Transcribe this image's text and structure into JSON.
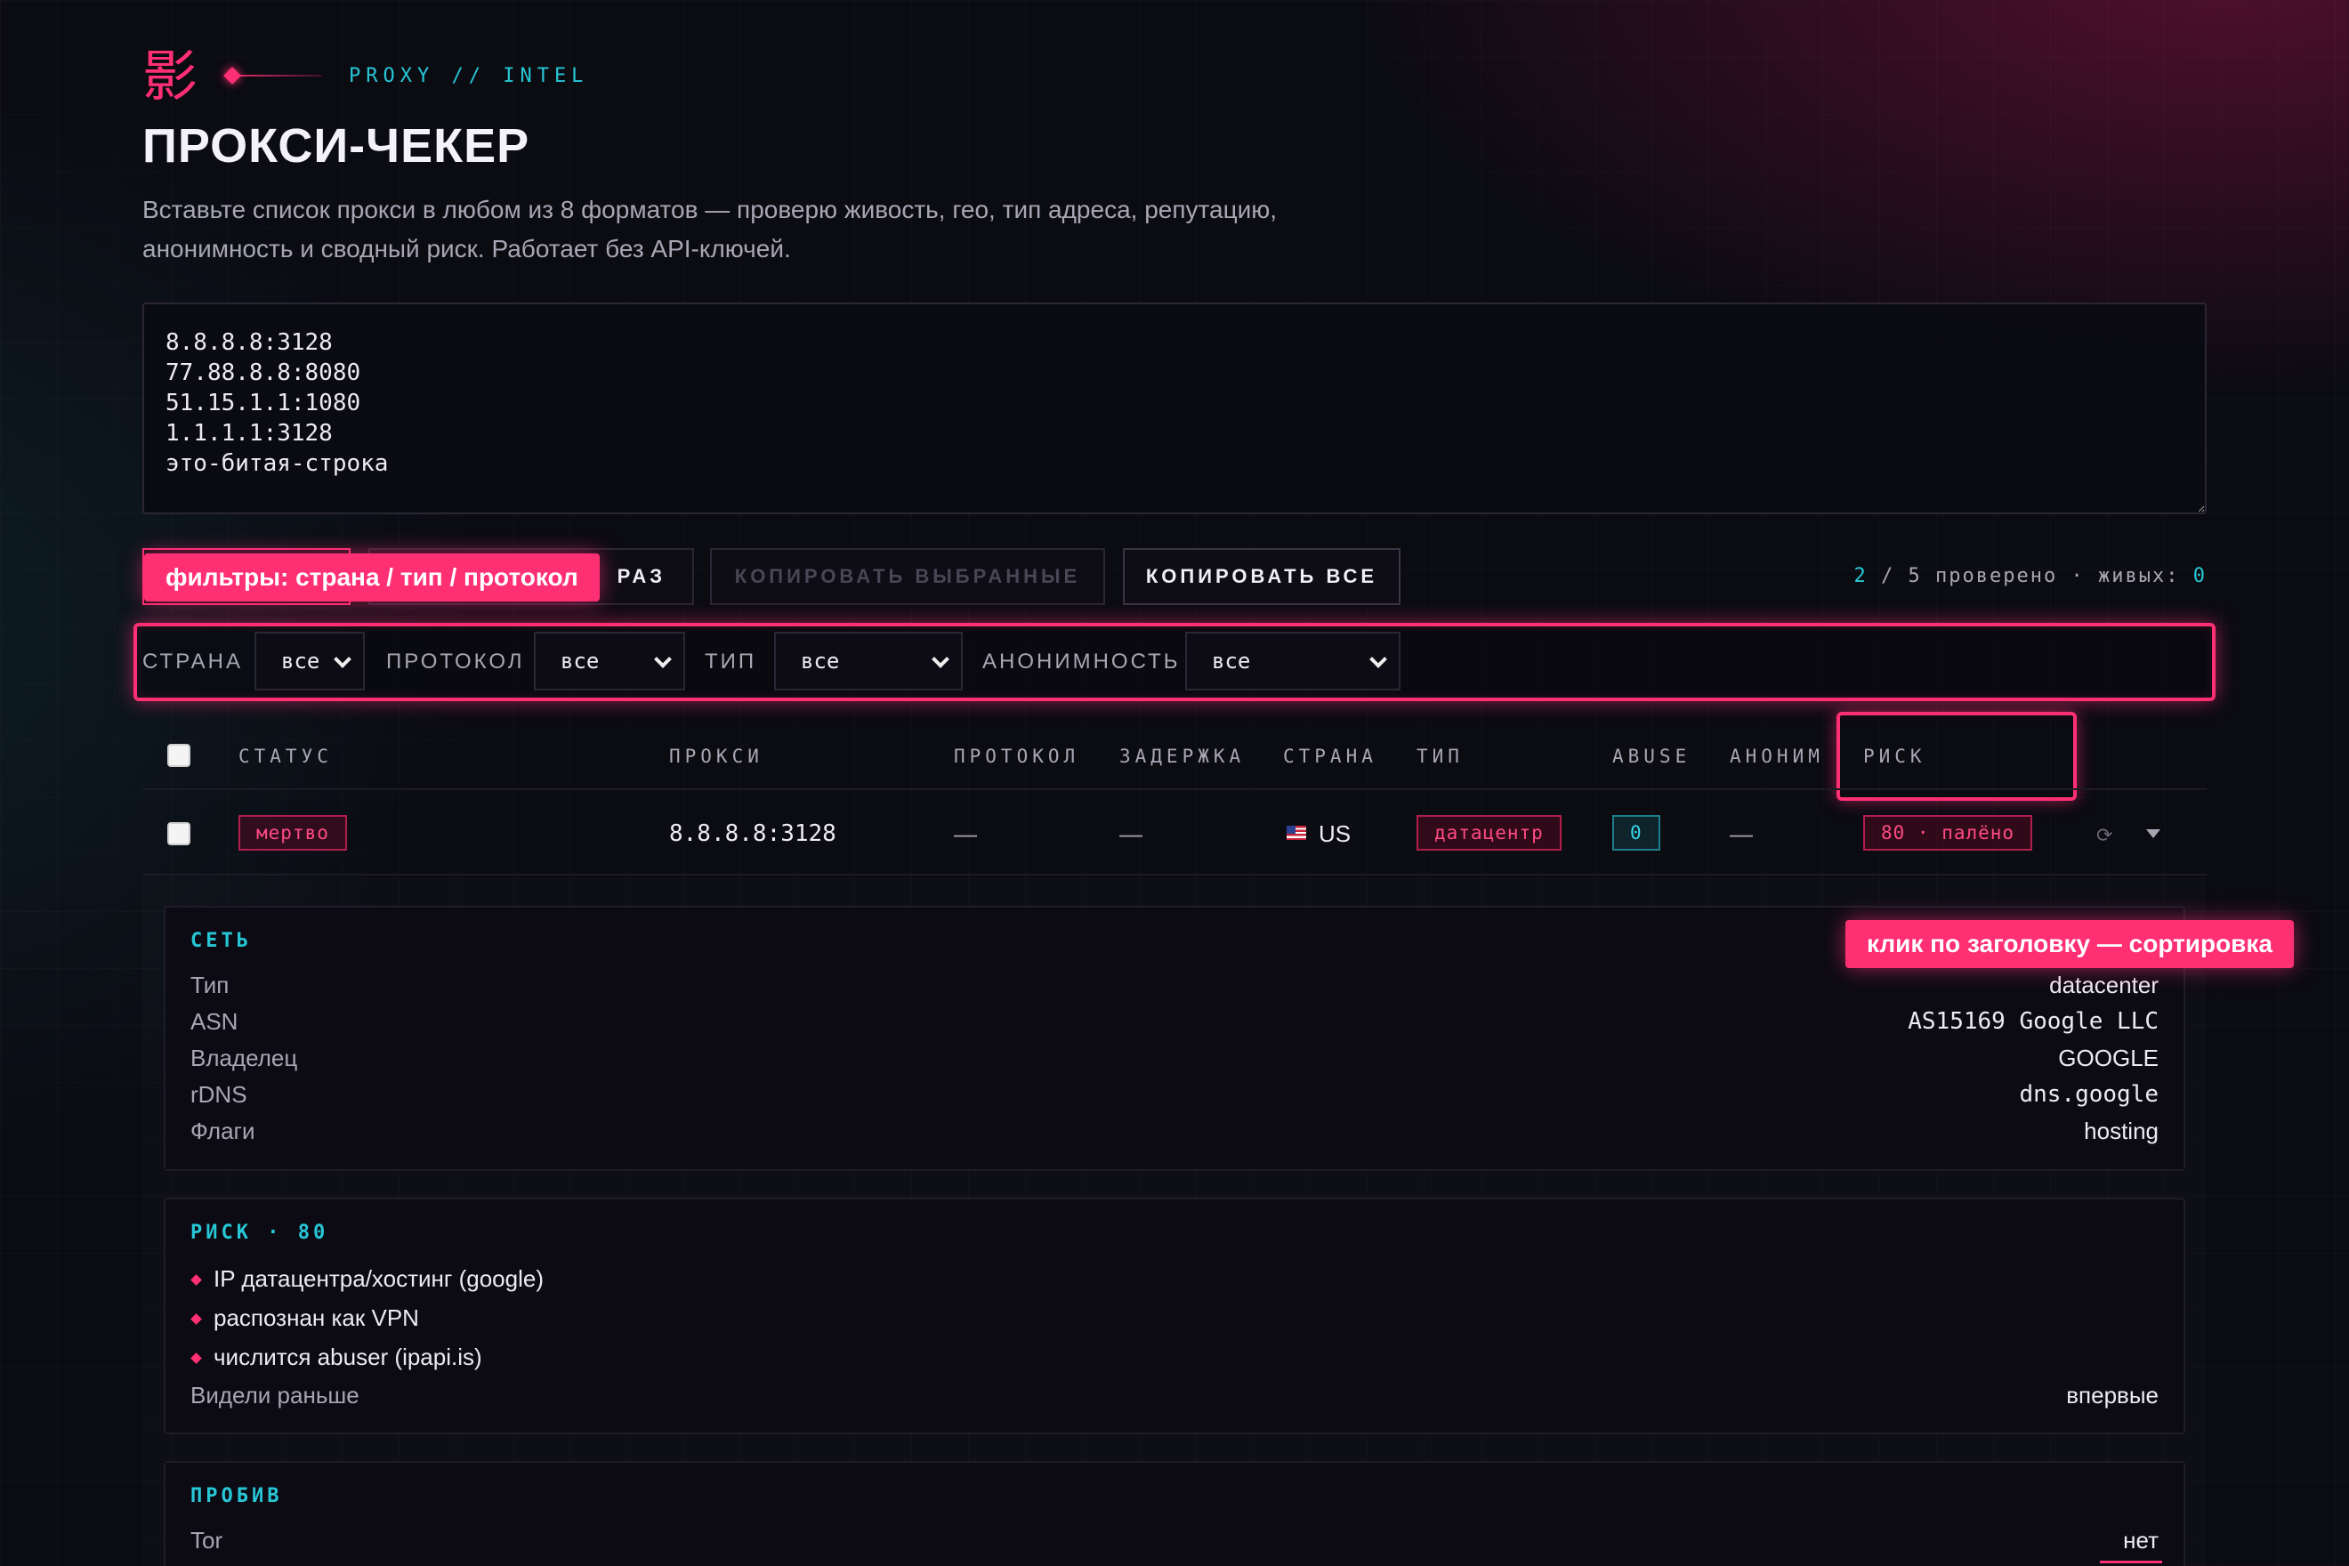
{
  "header": {
    "kanji": "影",
    "kicker": "PROXY // INTEL",
    "title": "ПРОКСИ-ЧЕКЕР",
    "subtitle": "Вставьте список прокси в любом из 8 форматов — проверю живость, гео, тип адреса, репутацию, анонимность и сводный риск. Работает без API-ключей."
  },
  "input": {
    "value": "8.8.8.8:3128\n77.88.8.8:8080\n51.15.1.1:1080\n1.1.1.1:3128\nэто-битая-строка"
  },
  "toolbar": {
    "check_label": "",
    "again_label": "РАЗ",
    "copy_selected_label": "КОПИРОВАТЬ ВЫБРАННЫЕ",
    "copy_all_label": "КОПИРОВАТЬ ВСЕ",
    "counter": {
      "checked": "2",
      "total": "5",
      "checked_label": "проверено",
      "alive_label": "живых:",
      "alive": "0"
    }
  },
  "tooltips": {
    "filters": "фильтры: страна / тип / протокол",
    "sort": "клик по заголовку — сортировка"
  },
  "filters": {
    "country_label": "СТРАНА",
    "country_value": "все",
    "protocol_label": "ПРОТОКОЛ",
    "protocol_value": "все",
    "type_label": "ТИП",
    "type_value": "все",
    "anonymity_label": "АНОНИМНОСТЬ",
    "anonymity_value": "все"
  },
  "table": {
    "columns": [
      "СТАТУС",
      "ПРОКСИ",
      "ПРОТОКОЛ",
      "ЗАДЕРЖКА",
      "СТРАНА",
      "ТИП",
      "ABUSE",
      "АНОНИМ",
      "РИСК"
    ],
    "rows": [
      {
        "status": "мертво",
        "proxy": "8.8.8.8:3128",
        "protocol": "—",
        "latency": "—",
        "country": "US",
        "type": "датацентр",
        "abuse": "0",
        "anonymity": "—",
        "risk": "80 · палёно",
        "refresh_glyph": "⟳"
      }
    ]
  },
  "details": {
    "network": {
      "title": "СЕТЬ",
      "items": [
        {
          "k": "Тип",
          "v": "datacenter"
        },
        {
          "k": "ASN",
          "v": "AS15169 Google LLC"
        },
        {
          "k": "Владелец",
          "v": "GOOGLE"
        },
        {
          "k": "rDNS",
          "v": "dns.google"
        },
        {
          "k": "Флаги",
          "v": "hosting"
        }
      ]
    },
    "risk": {
      "title": "РИСК · 80",
      "reasons": [
        "IP датацентра/хостинг (google)",
        "распознан как VPN",
        "числится abuser (ipapi.is)"
      ],
      "seen_label": "Видели раньше",
      "seen_value": "впервые"
    },
    "probe": {
      "title": "ПРОБИВ",
      "items": [
        {
          "k": "Tor",
          "v": "нет"
        }
      ]
    }
  },
  "colors": {
    "accent": "#ff2f74",
    "cyan": "#27c7d6",
    "background": "#0b0b12"
  }
}
